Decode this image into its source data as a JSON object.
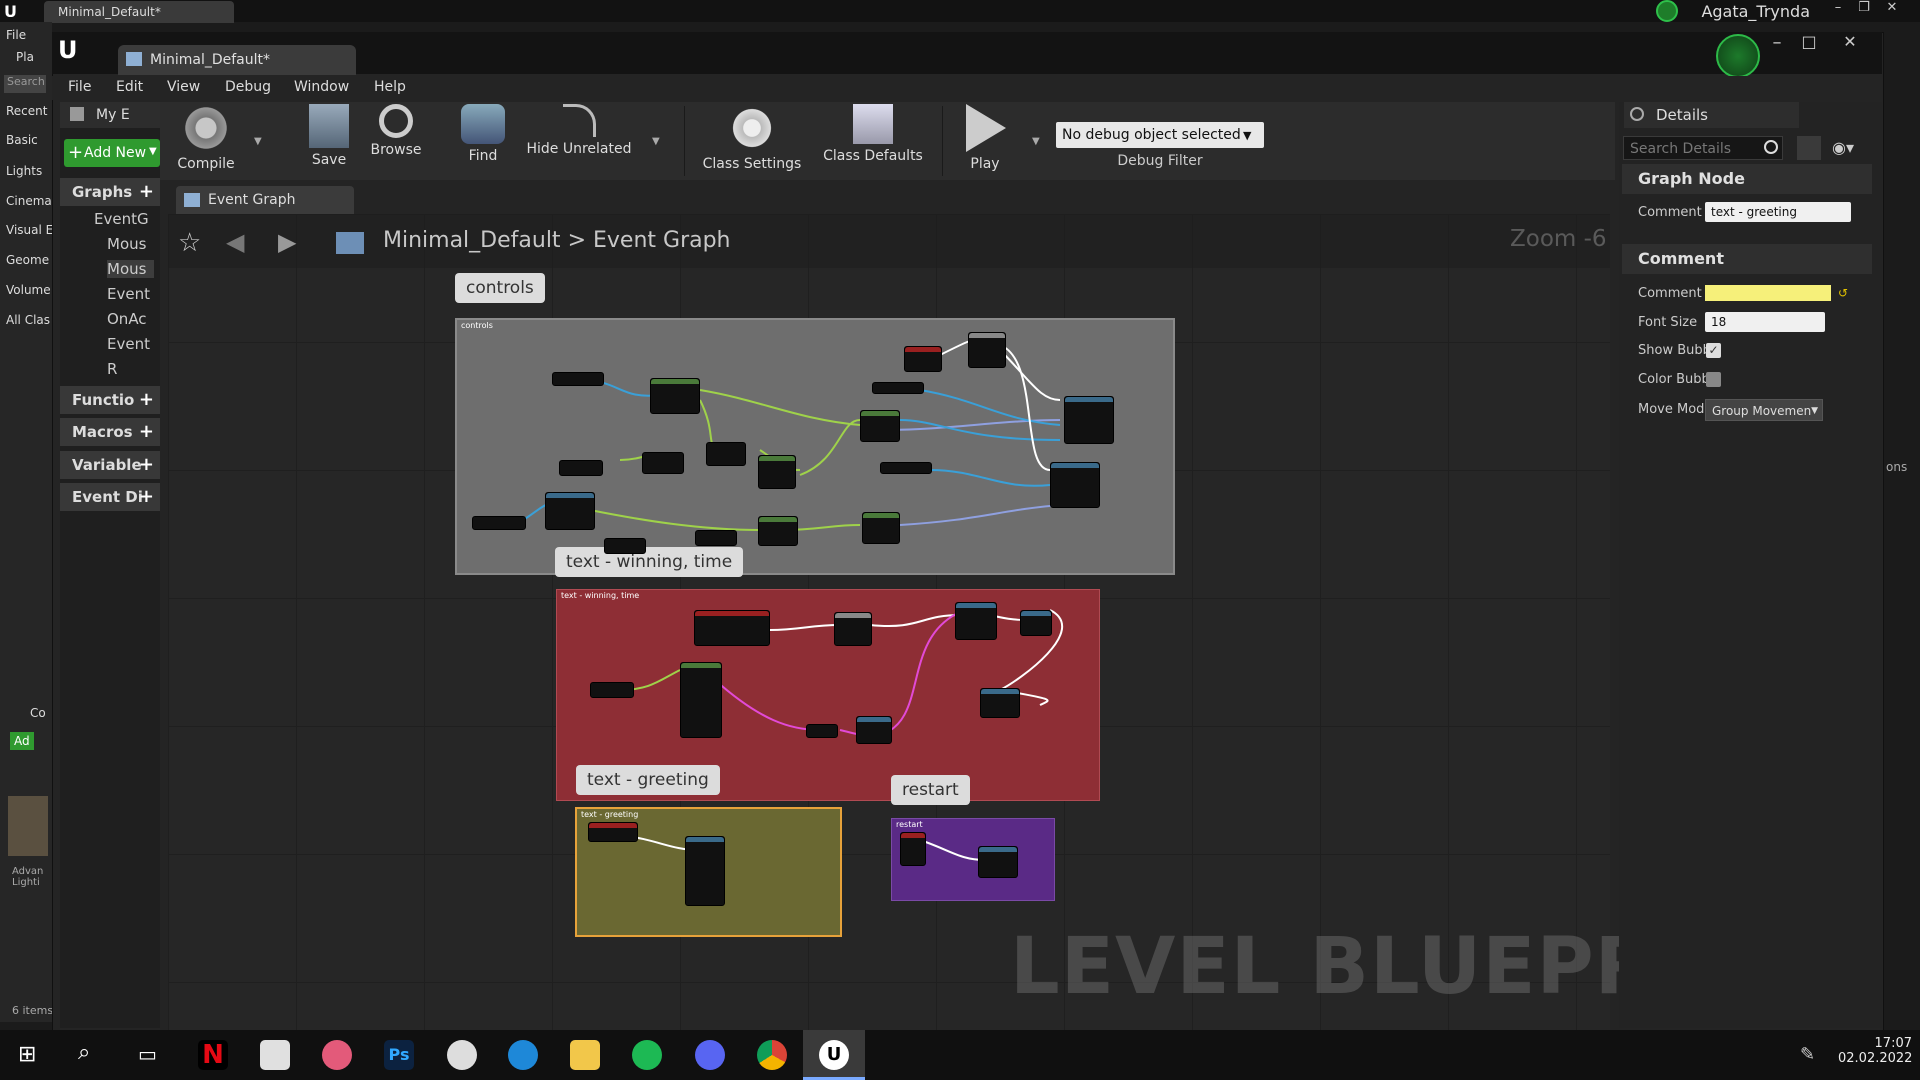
{
  "outer": {
    "tab_title": "Minimal_Default*",
    "user_name": "Agata_Trynda",
    "left_items": [
      "File",
      "Pla",
      "Search",
      "Recent",
      "Basic",
      "Lights",
      "Cinema",
      "Visual E",
      "Geome",
      "Volume",
      "All Clas",
      "Co",
      "Ad",
      "Advan Lighti",
      "6 items",
      "ons"
    ]
  },
  "window": {
    "doc_tab_title": "Minimal_Default*",
    "menu": [
      "File",
      "Edit",
      "View",
      "Debug",
      "Window",
      "Help"
    ]
  },
  "toolbar": {
    "buttons": [
      "Compile",
      "Save",
      "Browse",
      "Find",
      "Hide Unrelated",
      "Class Settings",
      "Class Defaults",
      "Play"
    ],
    "debug_object": "No debug object selected",
    "debug_filter_label": "Debug Filter"
  },
  "my_blueprint": {
    "tab_label": "My E",
    "add_new_label": "Add New",
    "sections": [
      "Graphs",
      "Functio",
      "Macros",
      "Variable",
      "Event Di"
    ],
    "graph_items": [
      "EventG",
      "Mous",
      "Mous",
      "Event",
      "OnAc",
      "Event",
      "R"
    ]
  },
  "graph": {
    "tab_label": "Event Graph",
    "breadcrumb_root": "Minimal_Default",
    "breadcrumb_separator": ">",
    "breadcrumb_leaf": "Event Graph",
    "zoom_label": "Zoom -6",
    "watermark": "LEVEL BLUEPRINT",
    "comments": [
      {
        "bubble": "controls",
        "title": "controls",
        "color": "#6e6e6e"
      },
      {
        "bubble": "text - winning, time",
        "title": "text - winning, time",
        "color": "#8e2e35"
      },
      {
        "bubble": "text - greeting",
        "title": "text - greeting",
        "color": "#6a6832"
      },
      {
        "bubble": "restart",
        "title": "restart",
        "color": "#5a2a86"
      }
    ]
  },
  "details": {
    "tab_label": "Details",
    "search_placeholder": "Search Details",
    "graph_node_header": "Graph Node",
    "comment_label": "Comment",
    "comment_value": "text - greeting",
    "comment_section_header": "Comment",
    "comment_color_label": "Comment",
    "comment_color": "#f6f07a",
    "font_size_label": "Font Size",
    "font_size_value": "18",
    "show_bubble_label": "Show Bubb",
    "show_bubble_checked": true,
    "color_bubble_label": "Color Bubb",
    "color_bubble_checked": false,
    "move_mode_label": "Move Mod",
    "move_mode_value": "Group Movemen"
  },
  "taskbar": {
    "time": "17:07",
    "date": "02.02.2022",
    "apps": [
      "start-icon",
      "search-icon",
      "task-view-icon",
      "netflix-icon",
      "store-icon",
      "photo-icon",
      "photoshop-icon",
      "app-icon",
      "edge-icon",
      "file-explorer-icon",
      "spotify-icon",
      "discord-icon",
      "chrome-icon",
      "unreal-icon"
    ]
  }
}
